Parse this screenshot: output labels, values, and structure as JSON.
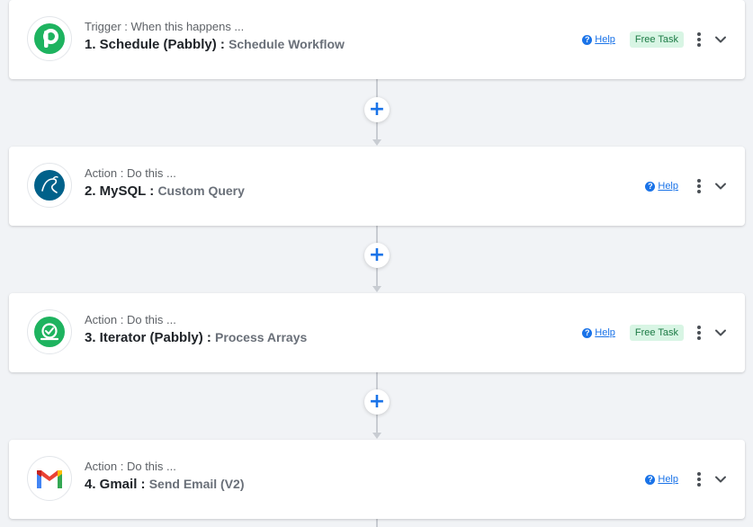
{
  "steps": [
    {
      "type_label": "Trigger : When this happens ...",
      "name": "1. Schedule (Pabbly)",
      "separator": " : ",
      "event": "Schedule Workflow",
      "icon": "pabbly-p-icon",
      "help": "Help",
      "badge": "Free Task"
    },
    {
      "type_label": "Action : Do this ...",
      "name": "2. MySQL",
      "separator": " : ",
      "event": "Custom Query",
      "icon": "mysql-dolphin-icon",
      "help": "Help"
    },
    {
      "type_label": "Action : Do this ...",
      "name": "3. Iterator (Pabbly)",
      "separator": " : ",
      "event": "Process Arrays",
      "icon": "iterator-icon",
      "help": "Help",
      "badge": "Free Task"
    },
    {
      "type_label": "Action : Do this ...",
      "name": "4. Gmail",
      "separator": " : ",
      "event": "Send Email (V2)",
      "icon": "gmail-icon",
      "help": "Help"
    }
  ],
  "add_button_symbol": "+",
  "help_icon_symbol": "?",
  "colors": {
    "accent": "#1a73e8",
    "badge_bg": "#d8f5e4",
    "badge_text": "#1b7a44",
    "pabbly_green": "#1eb35f",
    "mysql_blue": "#00618a"
  }
}
